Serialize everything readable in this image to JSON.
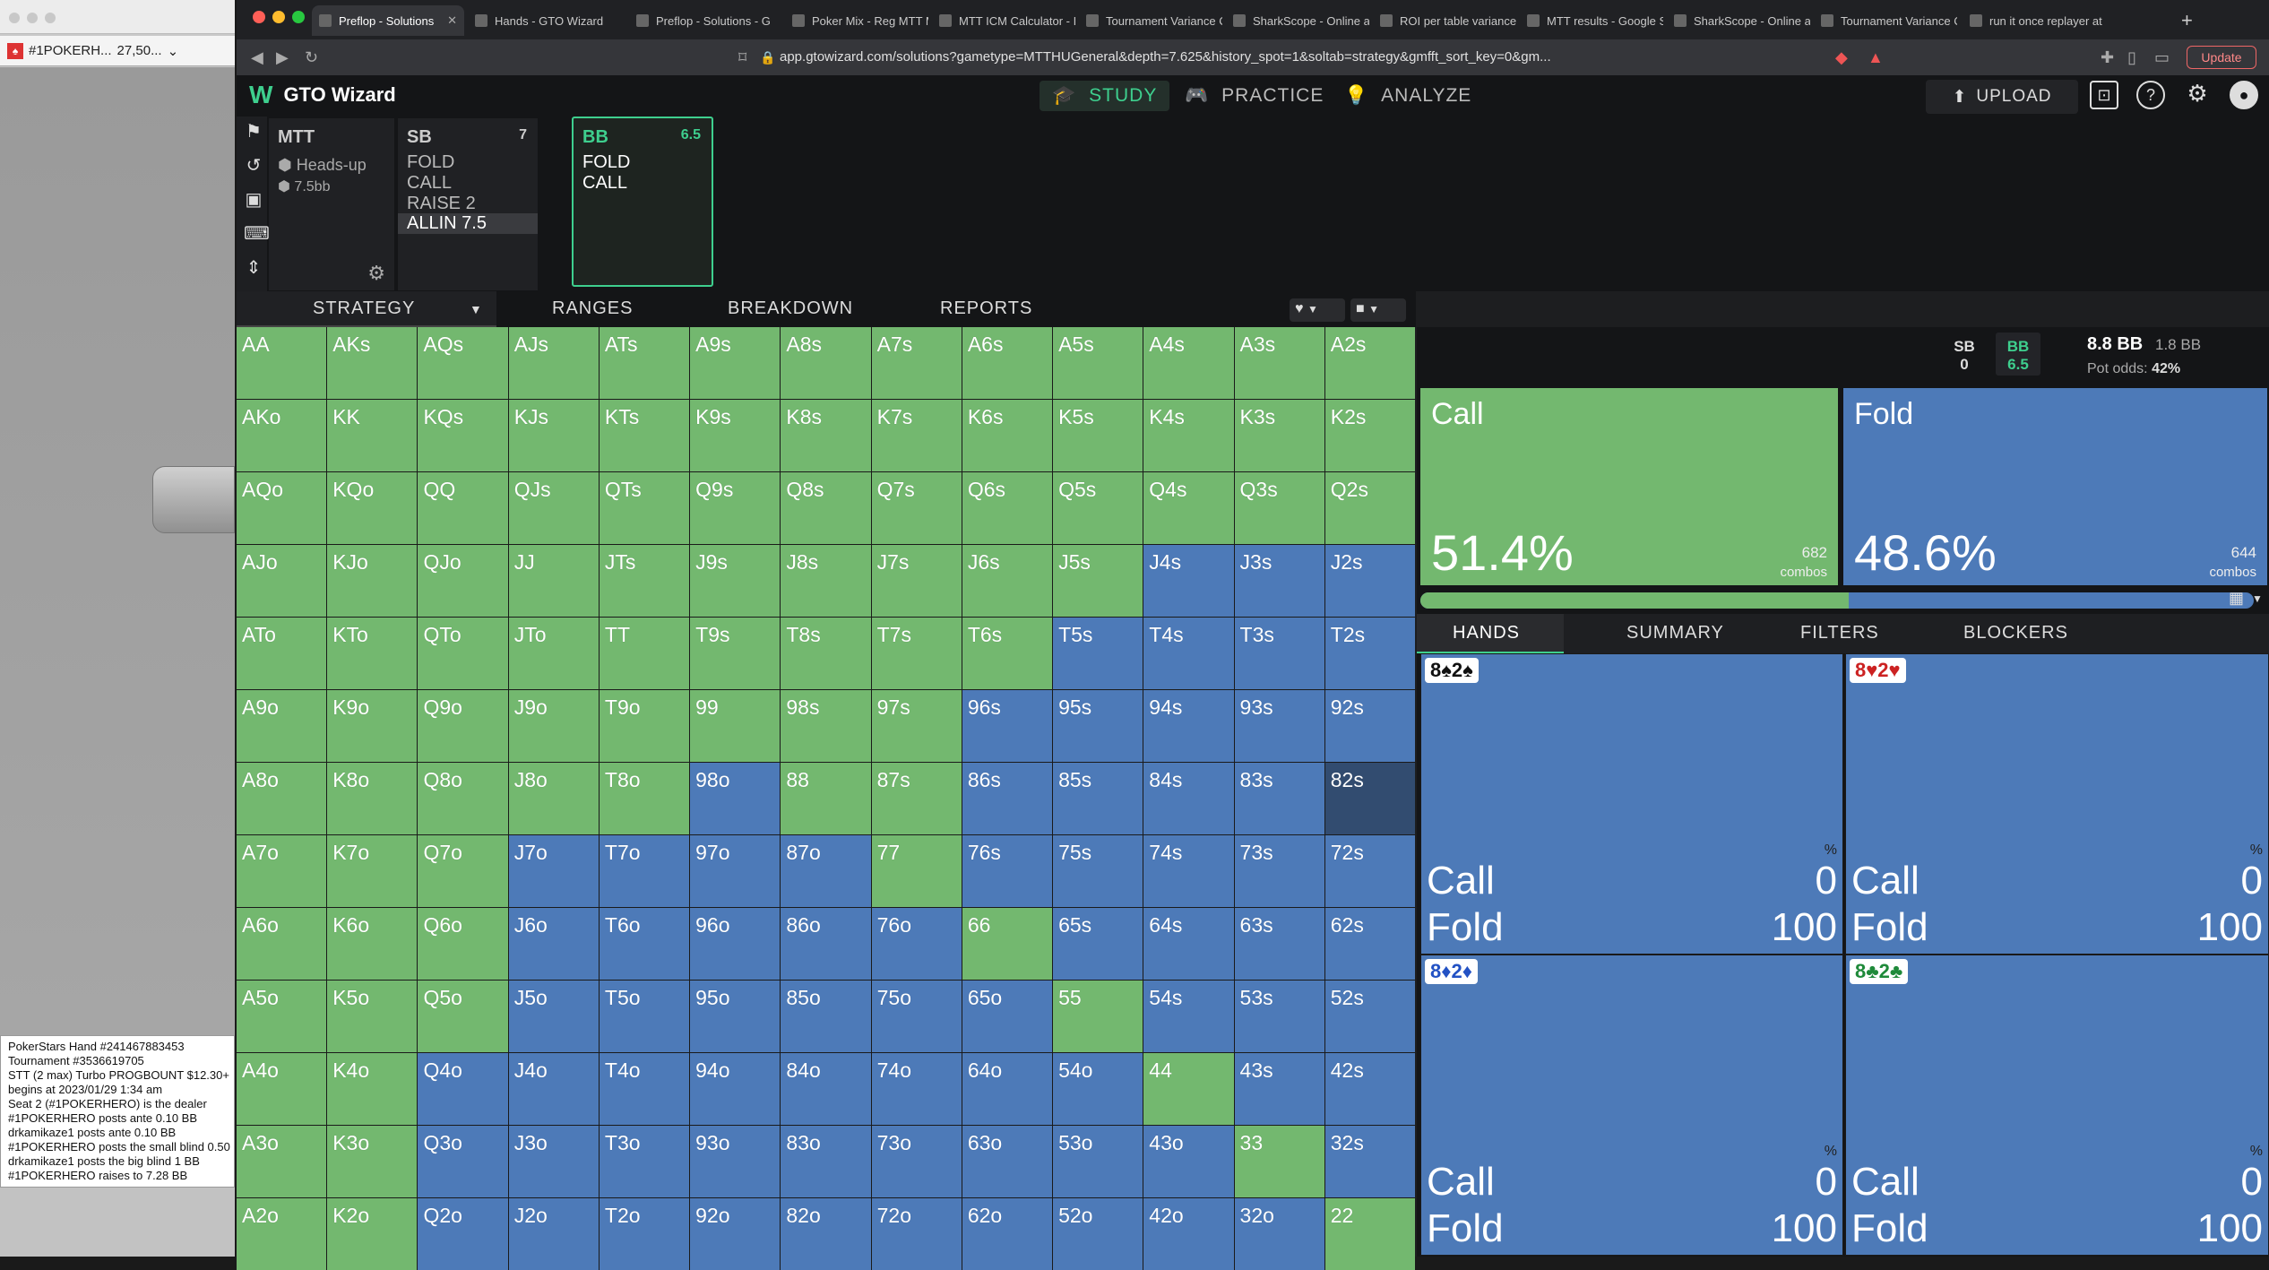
{
  "left_window": {
    "toolbar_text": "#1POKERH...",
    "toolbar_value": "27,50...",
    "log_lines": [
      "PokerStars Hand #241467883453",
      "Tournament #3536619705",
      "STT (2 max) Turbo PROGBOUNT $12.30+",
      "begins at 2023/01/29  1:34 am",
      "Seat 2 (#1POKERHERO) is the dealer",
      "#1POKERHERO posts ante 0.10 BB",
      "drkamikaze1 posts ante 0.10 BB",
      "#1POKERHERO posts the small blind 0.50",
      "drkamikaze1 posts the big blind 1 BB",
      "#1POKERHERO raises to 7.28 BB"
    ]
  },
  "browser": {
    "tabs": [
      "Preflop - Solutions",
      "Hands - GTO Wizard",
      "Preflop - Solutions - G",
      "Poker Mix - Reg MTT M",
      "MTT ICM Calculator - I",
      "Tournament Variance C",
      "SharkScope - Online an",
      "ROI per table variance",
      "MTT results - Google S",
      "SharkScope - Online an",
      "Tournament Variance C",
      "run it once replayer at"
    ],
    "url": "app.gtowizard.com/solutions?gametype=MTTHUGeneral&depth=7.625&history_spot=1&soltab=strategy&gmfft_sort_key=0&gm...",
    "update_label": "Update"
  },
  "app": {
    "logo": "GTO Wizard",
    "nav": [
      "STUDY",
      "PRACTICE",
      "ANALYZE"
    ],
    "upload": "UPLOAD",
    "accent": "#3ecf8e"
  },
  "spot": {
    "format": "MTT",
    "mode": "Heads-up",
    "depth": "7.5bb",
    "sb": {
      "name": "SB",
      "stack": "7",
      "actions": [
        "FOLD",
        "CALL",
        "RAISE 2",
        "ALLIN 7.5"
      ],
      "selected": "ALLIN 7.5"
    },
    "bb": {
      "name": "BB",
      "stack": "6.5",
      "actions": [
        "FOLD",
        "CALL"
      ]
    }
  },
  "strategy_tabs": [
    "STRATEGY",
    "RANGES",
    "BREAKDOWN",
    "REPORTS"
  ],
  "matrix": {
    "rows": [
      [
        "AA",
        "AKs",
        "AQs",
        "AJs",
        "ATs",
        "A9s",
        "A8s",
        "A7s",
        "A6s",
        "A5s",
        "A4s",
        "A3s",
        "A2s"
      ],
      [
        "AKo",
        "KK",
        "KQs",
        "KJs",
        "KTs",
        "K9s",
        "K8s",
        "K7s",
        "K6s",
        "K5s",
        "K4s",
        "K3s",
        "K2s"
      ],
      [
        "AQo",
        "KQo",
        "QQ",
        "QJs",
        "QTs",
        "Q9s",
        "Q8s",
        "Q7s",
        "Q6s",
        "Q5s",
        "Q4s",
        "Q3s",
        "Q2s"
      ],
      [
        "AJo",
        "KJo",
        "QJo",
        "JJ",
        "JTs",
        "J9s",
        "J8s",
        "J7s",
        "J6s",
        "J5s",
        "J4s",
        "J3s",
        "J2s"
      ],
      [
        "ATo",
        "KTo",
        "QTo",
        "JTo",
        "TT",
        "T9s",
        "T8s",
        "T7s",
        "T6s",
        "T5s",
        "T4s",
        "T3s",
        "T2s"
      ],
      [
        "A9o",
        "K9o",
        "Q9o",
        "J9o",
        "T9o",
        "99",
        "98s",
        "97s",
        "96s",
        "95s",
        "94s",
        "93s",
        "92s"
      ],
      [
        "A8o",
        "K8o",
        "Q8o",
        "J8o",
        "T8o",
        "98o",
        "88",
        "87s",
        "86s",
        "85s",
        "84s",
        "83s",
        "82s"
      ],
      [
        "A7o",
        "K7o",
        "Q7o",
        "J7o",
        "T7o",
        "97o",
        "87o",
        "77",
        "76s",
        "75s",
        "74s",
        "73s",
        "72s"
      ],
      [
        "A6o",
        "K6o",
        "Q6o",
        "J6o",
        "T6o",
        "96o",
        "86o",
        "76o",
        "66",
        "65s",
        "64s",
        "63s",
        "62s"
      ],
      [
        "A5o",
        "K5o",
        "Q5o",
        "J5o",
        "T5o",
        "95o",
        "85o",
        "75o",
        "65o",
        "55",
        "54s",
        "53s",
        "52s"
      ],
      [
        "A4o",
        "K4o",
        "Q4o",
        "J4o",
        "T4o",
        "94o",
        "84o",
        "74o",
        "64o",
        "54o",
        "44",
        "43s",
        "42s"
      ],
      [
        "A3o",
        "K3o",
        "Q3o",
        "J3o",
        "T3o",
        "93o",
        "83o",
        "73o",
        "63o",
        "53o",
        "43o",
        "33",
        "32s"
      ],
      [
        "A2o",
        "K2o",
        "Q2o",
        "J2o",
        "T2o",
        "92o",
        "82o",
        "72o",
        "62o",
        "52o",
        "42o",
        "32o",
        "22"
      ]
    ],
    "colors": [
      "ggggggggggggg",
      "ggggggggggggg",
      "ggggggggggggg",
      "ggggggggggbbb",
      "gggggggggbbbb",
      "ggggggggbbbbb",
      "gggggbggbbbbh",
      "gggbbbbgbbbbb",
      "gggbbbbbgbbbb",
      "gggbbbbbbgbbb",
      "ggbbbbbbbbgbb",
      "ggbbbbbbbbbgb",
      "ggbbbbbbbbbbg"
    ],
    "call_color": "#73b86f",
    "fold_color": "#4d7ab8"
  },
  "pot": {
    "sb_label": "SB",
    "sb_value": "0",
    "bb_label": "BB",
    "bb_value": "6.5",
    "pot": "8.8 BB",
    "call_amt": "1.8 BB",
    "pot_odds_label": "Pot odds:",
    "pot_odds": "42%"
  },
  "actions": {
    "call": {
      "label": "Call",
      "pct": "51.4%",
      "combos": "682",
      "combos_label": "combos",
      "fraction": 0.514
    },
    "fold": {
      "label": "Fold",
      "pct": "48.6%",
      "combos": "644",
      "combos_label": "combos"
    }
  },
  "detail_tabs": [
    "HANDS",
    "SUMMARY",
    "FILTERS",
    "BLOCKERS"
  ],
  "hands": [
    {
      "label": "8♠2♠",
      "suit_color": "#111",
      "pct_sym": "%",
      "call_label": "Call",
      "call": "0",
      "fold_label": "Fold",
      "fold": "100"
    },
    {
      "label": "8♥2♥",
      "suit_color": "#c22",
      "pct_sym": "%",
      "call_label": "Call",
      "call": "0",
      "fold_label": "Fold",
      "fold": "100"
    },
    {
      "label": "8♦2♦",
      "suit_color": "#2352c4",
      "pct_sym": "%",
      "call_label": "Call",
      "call": "0",
      "fold_label": "Fold",
      "fold": "100"
    },
    {
      "label": "8♣2♣",
      "suit_color": "#1f8a3a",
      "pct_sym": "%",
      "call_label": "Call",
      "call": "0",
      "fold_label": "Fold",
      "fold": "100"
    }
  ]
}
